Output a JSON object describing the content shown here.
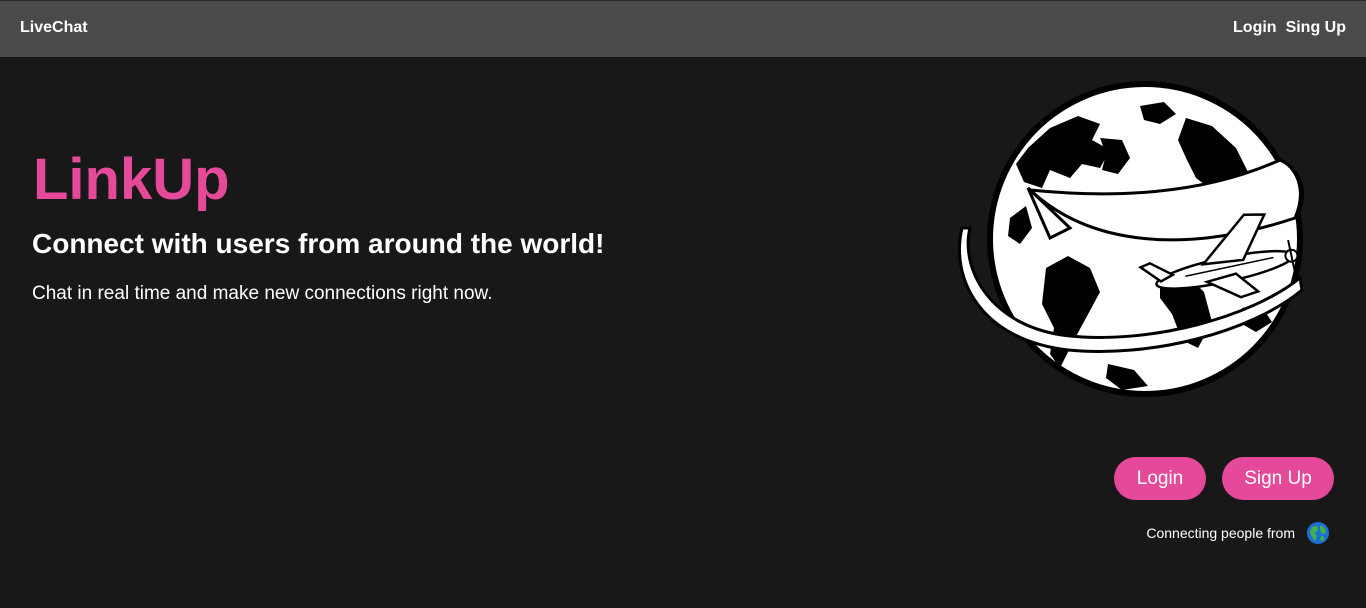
{
  "navbar": {
    "brand": "LiveChat",
    "links": [
      "Login",
      "Sing Up"
    ]
  },
  "hero": {
    "title": "LinkUp",
    "subtitle": "Connect with users from around the world!",
    "description": "Chat in real time and make new connections right now."
  },
  "actions": {
    "login_label": "Login",
    "signup_label": "Sign Up"
  },
  "footer": {
    "connecting_text": "Connecting people from",
    "icon": "earth-globe-icon"
  },
  "colors": {
    "accent": "#e5499a",
    "background": "#181818",
    "navbar": "#4a4a4a"
  }
}
